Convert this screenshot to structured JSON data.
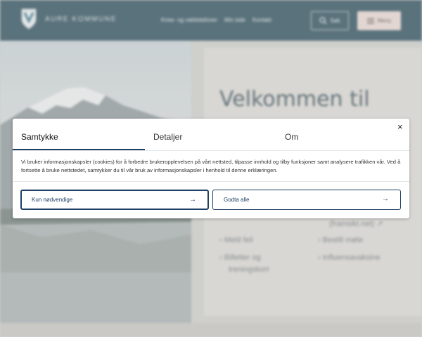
{
  "header": {
    "logo_text": "AURE KOMMUNE",
    "nav": [
      "Krise- og vakttelefoner",
      "Min side",
      "Kontakt"
    ],
    "search_label": "Søk",
    "menu_label": "Meny"
  },
  "main": {
    "welcome": "Velkommen til",
    "links": {
      "framsikt": "(framsikt.net)",
      "report_error": "Meld feil",
      "book_meeting": "Bestill møte",
      "tickets_line1": "Billetter og",
      "tickets_line2": "treningskort",
      "influenza": "Influensavaksine"
    }
  },
  "consent": {
    "tabs": {
      "consent": "Samtykke",
      "details": "Detaljer",
      "about": "Om"
    },
    "close_glyph": "×",
    "text": "Vi bruker informasjonskapsler (cookies) for å forbedre brukeropplevelsen på vårt nettsted, tilpasse innhold og tilby funksjoner samt analysere trafikken vår. Ved å fortsette å bruke nettstedet, samtykker du til vår bruk av informasjonskapsler i henhold til denne erklæringen.",
    "buttons": {
      "necessary": "Kun nødvendige",
      "accept_all": "Godta alle",
      "arrow_glyph": "→"
    }
  },
  "colors": {
    "header_bg": "#284a5a",
    "accent": "#1f3f66",
    "menu_bg": "#ead9d5"
  },
  "icons": [
    "shield-logo-icon",
    "search-icon",
    "menu-icon",
    "close-icon",
    "arrow-right-icon",
    "external-link-icon",
    "chevron-right-icon"
  ]
}
